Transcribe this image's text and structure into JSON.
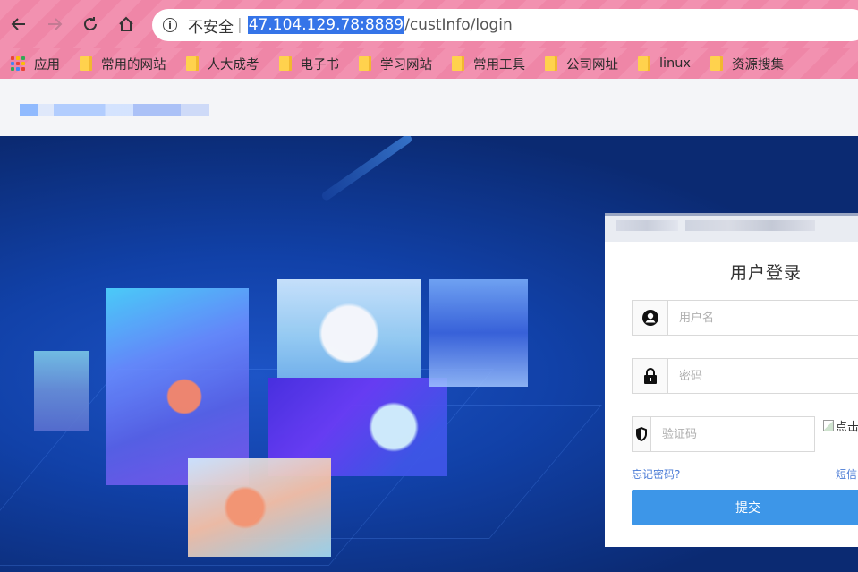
{
  "browser": {
    "security_text": "不安全",
    "separator": "|",
    "url_host": "47.104.129.78:8889",
    "url_path": "/custInfo/login",
    "back_icon": "back-arrow-icon",
    "forward_icon": "forward-arrow-icon",
    "reload_icon": "reload-icon",
    "home_icon": "home-icon",
    "accent": "#3574e8",
    "toolbar_color": "#f291b0"
  },
  "bookmarks": [
    {
      "label": "应用",
      "icon": "apps-icon"
    },
    {
      "label": "常用的网站",
      "icon": "folder-icon"
    },
    {
      "label": "人大成考",
      "icon": "folder-icon"
    },
    {
      "label": "电子书",
      "icon": "folder-icon"
    },
    {
      "label": "学习网站",
      "icon": "folder-icon"
    },
    {
      "label": "常用工具",
      "icon": "folder-icon"
    },
    {
      "label": "公司网址",
      "icon": "folder-icon"
    },
    {
      "label": "linux",
      "icon": "folder-icon"
    },
    {
      "label": "资源搜集",
      "icon": "folder-icon"
    }
  ],
  "login": {
    "title": "用户登录",
    "username_placeholder": "用户名",
    "password_placeholder": "密码",
    "captcha_placeholder": "验证码",
    "captcha_alt": "点击",
    "forgot_password": "忘记密码?",
    "sms_login": "短信",
    "submit": "提交",
    "button_color": "#3d96e8"
  }
}
